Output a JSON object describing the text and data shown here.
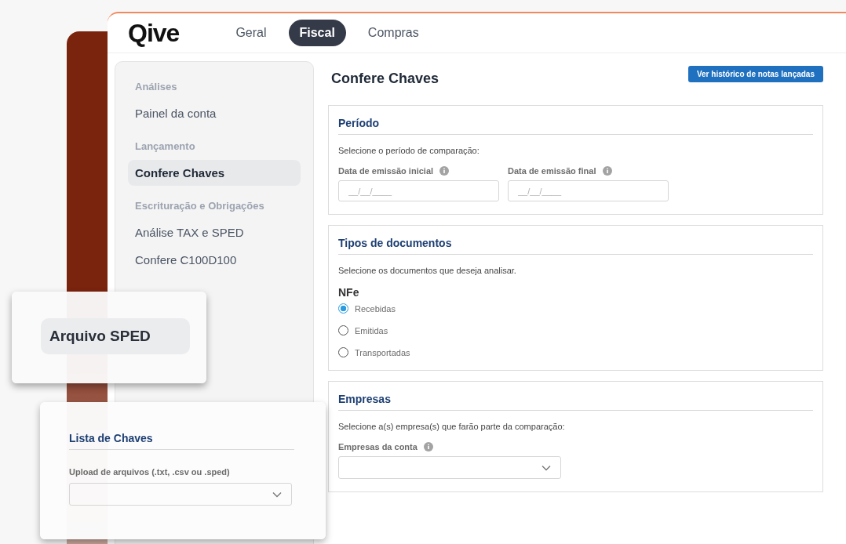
{
  "logo": "Qive",
  "tabs": [
    {
      "label": "Geral",
      "selected": false
    },
    {
      "label": "Fiscal",
      "selected": true
    },
    {
      "label": "Compras",
      "selected": false
    }
  ],
  "sidebar": {
    "groups": [
      {
        "heading": "Análises",
        "items": [
          {
            "label": "Painel da conta",
            "selected": false
          }
        ]
      },
      {
        "heading": "Lançamento",
        "items": [
          {
            "label": "Confere Chaves",
            "selected": true
          }
        ]
      },
      {
        "heading": "Escrituração e Obrigações",
        "items": [
          {
            "label": "Análise TAX e SPED",
            "selected": false
          },
          {
            "label": "Confere C100D100",
            "selected": false
          }
        ]
      }
    ]
  },
  "page_title": "Confere Chaves",
  "history_button": "Ver histórico de notas lançadas",
  "periodo": {
    "title": "Período",
    "description": "Selecione o período de comparação:",
    "fields": [
      {
        "label": "Data de emissão inicial",
        "placeholder": "__/__/____"
      },
      {
        "label": "Data de emissão final",
        "placeholder": "__/__/____"
      }
    ]
  },
  "tipos": {
    "title": "Tipos de documentos",
    "description": "Selecione os documentos que deseja analisar.",
    "group_label": "NFe",
    "options": [
      {
        "label": "Recebidas",
        "selected": true
      },
      {
        "label": "Emitidas",
        "selected": false
      },
      {
        "label": "Transportadas",
        "selected": false
      }
    ]
  },
  "empresas": {
    "title": "Empresas",
    "description": "Selecione a(s) empresa(s) que farão parte da comparação:",
    "select_label": "Empresas da conta"
  },
  "overlays": {
    "menu_item": "Arquivo SPED",
    "upload_card": {
      "title": "Lista de Chaves",
      "select_label": "Upload de arquivos (.txt, .csv ou .sped)"
    }
  }
}
